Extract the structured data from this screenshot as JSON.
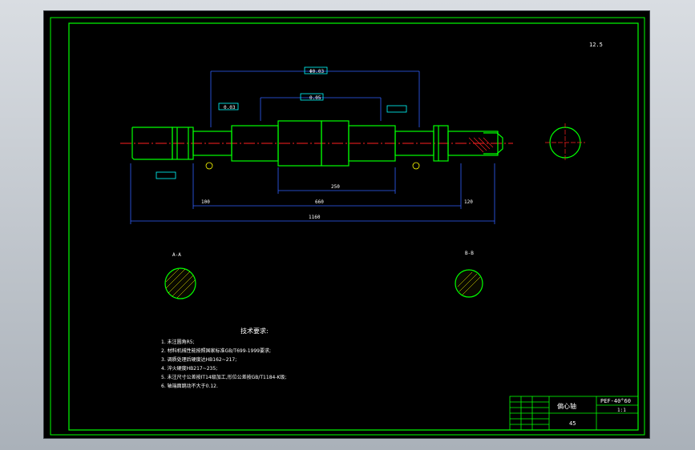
{
  "drawing": {
    "title": "偏心轴",
    "model": "PEF-40°60",
    "scale": "1:1",
    "sheet_no": "45",
    "top_right_roughness": "12.5",
    "section_a_label": "A-A",
    "section_b_label": "B-B",
    "tech_title": "技术要求:",
    "notes": [
      "1. 未注圆角R5;",
      "2. 材料机械性能按照国家标准GB/T699-1999要求;",
      "3. 调质处理后硬度达HB162~217;",
      "4. 淬火硬度HB217~235;",
      "5. 未注尺寸公差按IT14级加工,形位公差按GB/T1184-K级;",
      "6. 轴端面跳动不大于0.12."
    ],
    "dims": {
      "total": "1160",
      "span": "660",
      "center": "250",
      "left": "100",
      "right": "120",
      "concentric": "Φ0.03",
      "runout1": "0.05",
      "runout2": "0.03"
    },
    "colors": {
      "frame": "#00ff00",
      "outline": "#00ff00",
      "dimension": "#3060ff",
      "text": "#ffffff",
      "centerline": "#ff2020",
      "hatch": "#ffff00",
      "hatch2": "#ff2020",
      "background": "#000000",
      "cyan": "#00ffff"
    }
  }
}
